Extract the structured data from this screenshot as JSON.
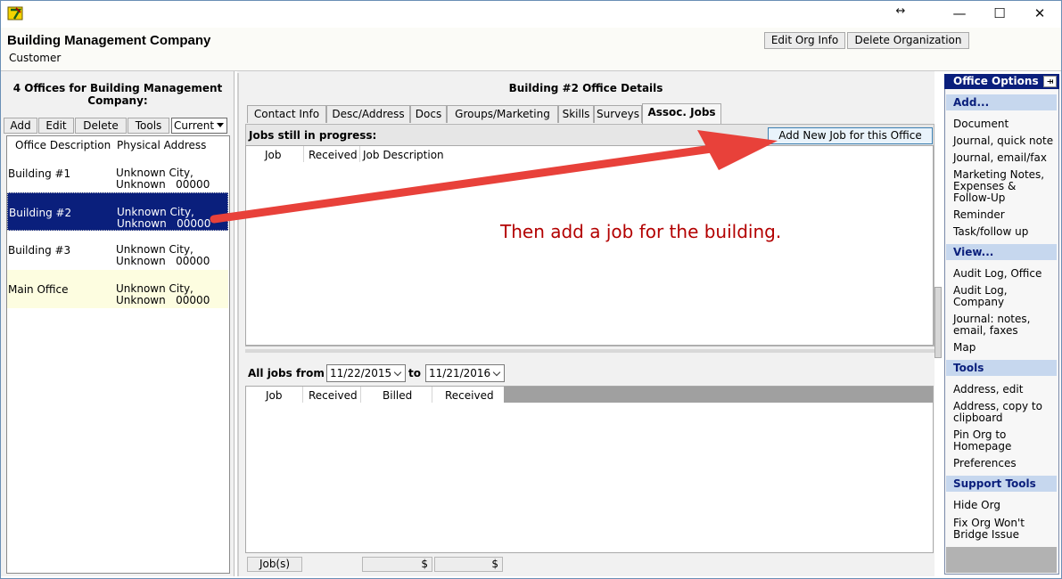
{
  "window": {
    "resize_glyph": "↔",
    "min_glyph": "—",
    "max_glyph": "☐",
    "close_glyph": "✕"
  },
  "org": {
    "name": "Building Management Company",
    "type": "Customer",
    "edit_btn": "Edit Org Info",
    "delete_btn": "Delete Organization"
  },
  "left": {
    "title": "4 Offices for Building Management Company:",
    "buttons": {
      "add": "Add",
      "edit": "Edit",
      "delete": "Delete",
      "tools": "Tools"
    },
    "filter": "Current",
    "columns": [
      "Office Description",
      "Physical Address"
    ],
    "offices": [
      {
        "name": "Building #1",
        "address": "Unknown City,\nUnknown   00000"
      },
      {
        "name": "Building #2",
        "address": "Unknown City,\nUnknown   00000"
      },
      {
        "name": "Building #3",
        "address": "Unknown City,\nUnknown   00000"
      },
      {
        "name": "Main Office",
        "address": "Unknown City,\nUnknown   00000"
      }
    ]
  },
  "middle": {
    "title": "Building #2 Office Details",
    "tabs": [
      "Contact Info",
      "Desc/Address",
      "Docs",
      "Groups/Marketing",
      "Skills",
      "Surveys",
      "Assoc. Jobs"
    ],
    "in_progress_label": "Jobs still in progress:",
    "add_job_btn": "Add New Job for this Office",
    "in_progress_columns": [
      "Job",
      "Received",
      "Job Description"
    ],
    "all_jobs_label": "All jobs from",
    "date_from": "11/22/2015",
    "to_label": "to",
    "date_to": "11/21/2016",
    "all_jobs_columns": [
      "Job",
      "Received",
      "Billed",
      "Received"
    ],
    "footer": {
      "jobs": "Job(s)",
      "cur1": "$",
      "cur2": "$"
    }
  },
  "annotation": "Then add a job for the building.",
  "options": {
    "title": "Office Options",
    "groups": [
      {
        "label": "Add...",
        "items": [
          "Document",
          "Journal, quick note",
          "Journal, email/fax",
          "Marketing Notes, Expenses & Follow-Up",
          "Reminder",
          "Task/follow up"
        ]
      },
      {
        "label": "View...",
        "items": [
          "Audit Log, Office",
          "Audit Log, Company",
          "Journal: notes, email, faxes",
          "Map"
        ]
      },
      {
        "label": "Tools",
        "items": [
          "Address, edit",
          "Address, copy to clipboard",
          "Pin Org to Homepage",
          "Preferences"
        ]
      },
      {
        "label": "Support Tools",
        "items": [
          "Hide Org",
          "Fix Org Won't Bridge Issue"
        ]
      }
    ]
  },
  "colors": {
    "selection": "#0a1f7c",
    "arrow": "#e8413a",
    "annotation": "#b30000",
    "group_bg": "#c6d7ee"
  },
  "icons": [
    "app-logo-icon",
    "resize-icon",
    "minimize-icon",
    "maximize-icon",
    "close-icon",
    "pin-icon",
    "dropdown-arrow-icon"
  ]
}
